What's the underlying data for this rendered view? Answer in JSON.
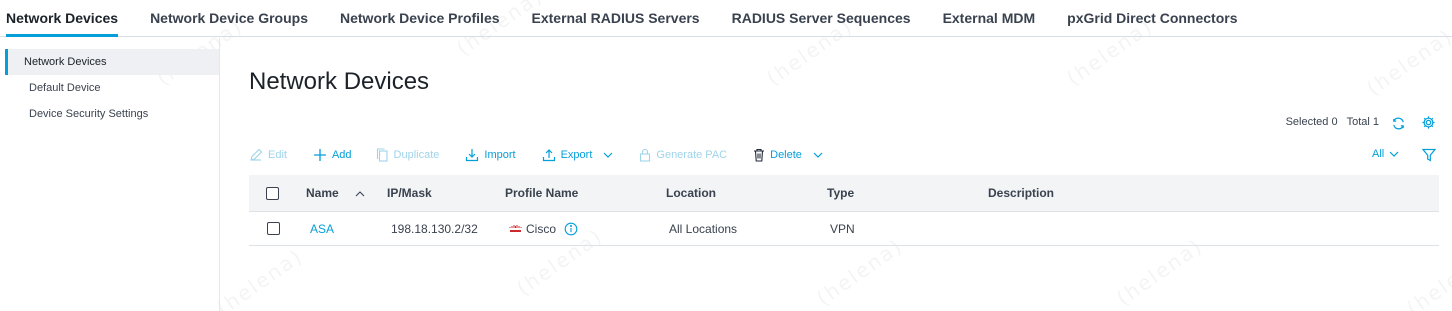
{
  "top_tabs": [
    {
      "label": "Network Devices",
      "active": true
    },
    {
      "label": "Network Device Groups",
      "active": false
    },
    {
      "label": "Network Device Profiles",
      "active": false
    },
    {
      "label": "External RADIUS Servers",
      "active": false
    },
    {
      "label": "RADIUS Server Sequences",
      "active": false
    },
    {
      "label": "External MDM",
      "active": false
    },
    {
      "label": "pxGrid Direct Connectors",
      "active": false
    }
  ],
  "sidebar": {
    "items": [
      {
        "label": "Network Devices",
        "active": true
      },
      {
        "label": "Default Device",
        "active": false
      },
      {
        "label": "Device Security Settings",
        "active": false
      }
    ]
  },
  "page_title": "Network Devices",
  "counts": {
    "selected": "Selected 0",
    "total": "Total 1"
  },
  "toolbar": {
    "edit": "Edit",
    "add": "Add",
    "duplicate": "Duplicate",
    "import": "Import",
    "export": "Export",
    "generate_pac": "Generate PAC",
    "delete": "Delete"
  },
  "filter": {
    "selected": "All"
  },
  "table": {
    "columns": [
      "Name",
      "IP/Mask",
      "Profile Name",
      "Location",
      "Type",
      "Description"
    ],
    "rows": [
      {
        "name": "ASA",
        "ip_mask": "198.18.130.2/32",
        "profile": "Cisco",
        "location": "All Locations",
        "type": "VPN",
        "description": ""
      }
    ]
  },
  "colors": {
    "accent": "#049fd9",
    "disabled": "#9fd4ea",
    "text": "#39424e"
  },
  "watermark": "(helena)"
}
